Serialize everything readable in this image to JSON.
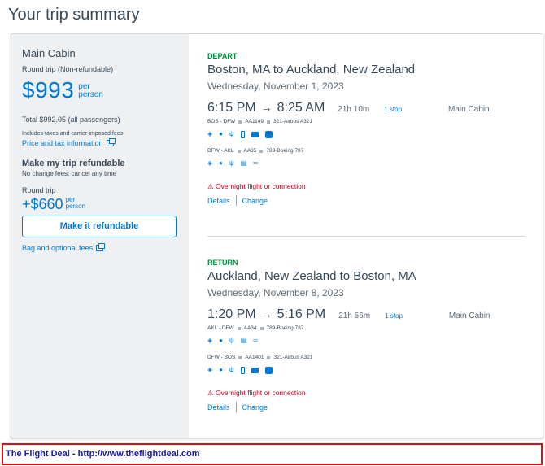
{
  "page_title": "Your trip summary",
  "summary": {
    "cabin": "Main Cabin",
    "trip_type": "Round trip (Non-refundable)",
    "price": "$993",
    "per": "per",
    "person": "person",
    "total": "Total $992.05 (all passengers)",
    "includes": "Includes taxes and carrier-imposed fees",
    "price_tax_link": "Price and tax information",
    "refund_title": "Make my trip refundable",
    "refund_sub": "No change fees; cancel any time",
    "round_trip_label": "Round trip",
    "addon_price": "+$660",
    "refund_button": "Make it refundable",
    "bag_fees_link": "Bag and optional fees"
  },
  "depart": {
    "label": "DEPART",
    "route": "Boston, MA to Auckland, New Zealand",
    "date": "Wednesday, November 1, 2023",
    "dep_time": "6:15 PM",
    "arrow": "→",
    "arr_time": "8:25 AM",
    "duration": "21h 10m",
    "stops": "1 stop",
    "cabin": "Main Cabin",
    "leg1": {
      "route": "BOS - DFW",
      "flight": "AA1149",
      "aircraft": "321-Airbus A321"
    },
    "leg2": {
      "route": "DFW - AKL",
      "flight": "AA35",
      "aircraft": "789-Boeing 787"
    },
    "warning": "Overnight flight or connection",
    "details": "Details",
    "change": "Change"
  },
  "return": {
    "label": "RETURN",
    "route": "Auckland, New Zealand to Boston, MA",
    "date": "Wednesday, November 8, 2023",
    "dep_time": "1:20 PM",
    "arrow": "→",
    "arr_time": "5:16 PM",
    "duration": "21h 56m",
    "stops": "1 stop",
    "cabin": "Main Cabin",
    "leg1": {
      "route": "AKL - DFW",
      "flight": "AA34",
      "aircraft": "789-Boeing 787"
    },
    "leg2": {
      "route": "DFW - BOS",
      "flight": "AA1401",
      "aircraft": "321-Airbus A321"
    },
    "warning": "Overnight flight or connection",
    "details": "Details",
    "change": "Change"
  },
  "footer": "The Flight Deal - http://www.theflightdeal.com",
  "colors": {
    "brand_blue": "#0078d2",
    "depart_green": "#008e3e",
    "warning_red": "#c30019",
    "footer_border": "#e01010"
  }
}
